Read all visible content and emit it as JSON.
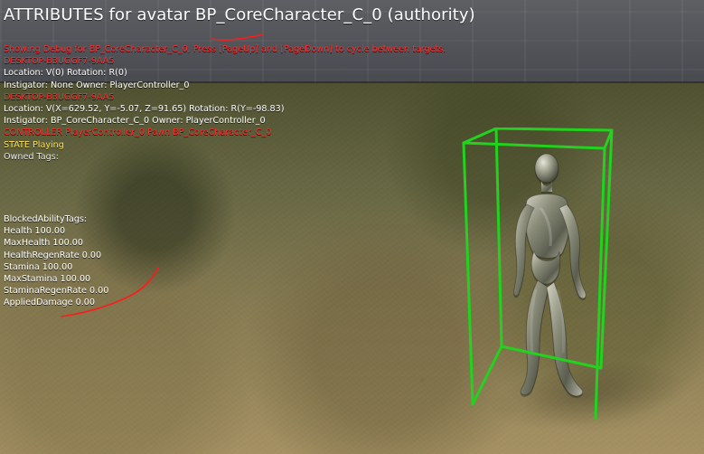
{
  "hud": {
    "title": "ATTRIBUTES for avatar BP_CoreCharacter_C_0 (authority)",
    "lines": [
      {
        "text": "Showing Debug for BP_CoreCharacter_C_0, Press [PageUp] and [PageDown] to cycle between targets.",
        "color": "red"
      },
      {
        "text": "DESKTOP-B3UGGF7-9AA5",
        "color": "red"
      },
      {
        "text": "Location: V(0) Rotation: R(0)",
        "color": "white"
      },
      {
        "text": " Instigator: None Owner: PlayerController_0",
        "color": "white"
      },
      {
        "text": "DESKTOP-B3UGGF7-9AA5",
        "color": "red"
      },
      {
        "text": "Location: V(X=629.52, Y=-5.07, Z=91.65) Rotation: R(Y=-98.83)",
        "color": "white"
      },
      {
        "text": " Instigator: BP_CoreCharacter_C_0 Owner: PlayerController_0",
        "color": "white"
      },
      {
        "text": "CONTROLLER PlayerController_0 Pawn BP_CoreCharacter_C_0",
        "color": "red"
      },
      {
        "text": "STATE Playing",
        "color": "yellow"
      },
      {
        "text": "Owned Tags:",
        "color": "lightgray"
      }
    ],
    "attributes": [
      "BlockedAbilityTags:",
      "Health 100.00",
      "MaxHealth 100.00",
      "HealthRegenRate 0.00",
      "Stamina 100.00",
      "MaxStamina 100.00",
      "StaminaRegenRate 0.00",
      "AppliedDamage 0.00"
    ]
  },
  "colors": {
    "hud_red": "#ff2d2d",
    "hud_white": "#ffffff",
    "hud_yellow": "#ffe44d",
    "debug_green": "#22d21f",
    "scribble_red": "#ff1a1a"
  }
}
